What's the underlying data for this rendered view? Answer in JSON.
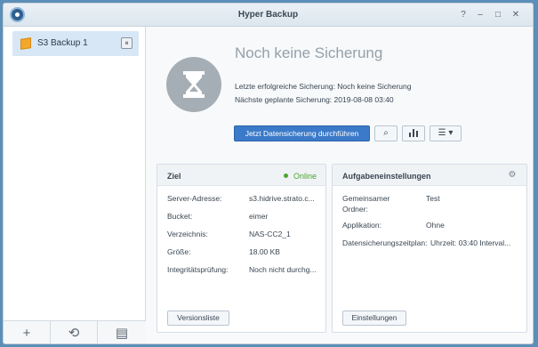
{
  "window": {
    "title": "Hyper Backup",
    "controls": [
      "?",
      "–",
      "□",
      "✕"
    ]
  },
  "sidebar": {
    "tasks": [
      {
        "label": "S3 Backup 1",
        "icon": "box-icon",
        "status_icon": "status-icon"
      }
    ],
    "footer": [
      {
        "icon": "add-icon",
        "glyph": "+"
      },
      {
        "icon": "history-icon",
        "glyph": "⟲"
      },
      {
        "icon": "log-icon",
        "glyph": "▤"
      }
    ]
  },
  "main": {
    "status_title": "Noch keine Sicherung",
    "last_backup": "Letzte erfolgreiche Sicherung: Noch keine Sicherung",
    "next_backup": "Nächste geplante Sicherung: 2019-08-08 03:40",
    "primary_button": "Jetzt Datensicherung durchführen",
    "icon_buttons": [
      "search-icon",
      "chart-icon",
      "menu-icon"
    ]
  },
  "target_panel": {
    "title": "Ziel",
    "status": "Online",
    "rows": [
      {
        "label": "Server-Adresse:",
        "value": "s3.hidrive.strato.c..."
      },
      {
        "label": "Bucket:",
        "value": "eimer"
      },
      {
        "label": "Verzeichnis:",
        "value": "NAS-CC2_1"
      },
      {
        "label": "Größe:",
        "value": "18.00 KB"
      },
      {
        "label": "Integritätsprüfung:",
        "value": "Noch nicht durchg..."
      }
    ],
    "button": "Versionsliste"
  },
  "task_panel": {
    "title": "Aufgabeneinstellungen",
    "rows": [
      {
        "label": "Gemeinsamer",
        "label2": "Ordner:",
        "value": "Test"
      },
      {
        "label": "Applikation:",
        "value": "Ohne"
      },
      {
        "label": "Datensicherungszeitplan:",
        "value": "Uhrzeit: 03:40 Interval..."
      }
    ],
    "button": "Einstellungen"
  }
}
